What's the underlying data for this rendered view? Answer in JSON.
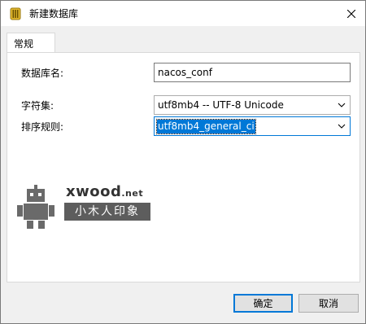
{
  "window": {
    "title": "新建数据库",
    "app_icon": "database-icon",
    "close_icon": "close-icon"
  },
  "tabs": [
    {
      "label": "常规",
      "active": true
    }
  ],
  "form": {
    "db_name": {
      "label": "数据库名:",
      "value": "nacos_conf"
    },
    "charset": {
      "label": "字符集:",
      "value": "utf8mb4 -- UTF-8 Unicode"
    },
    "collation": {
      "label": "排序规则:",
      "value": "utf8mb4_general_ci"
    }
  },
  "watermark": {
    "site": "xwood",
    "site_suffix": ".net",
    "name": "小木人印象"
  },
  "buttons": {
    "ok": "确定",
    "cancel": "取消"
  },
  "colors": {
    "focus_blue": "#0078d7",
    "panel_bg": "#ffffff",
    "window_bg": "#f0f0f0"
  }
}
